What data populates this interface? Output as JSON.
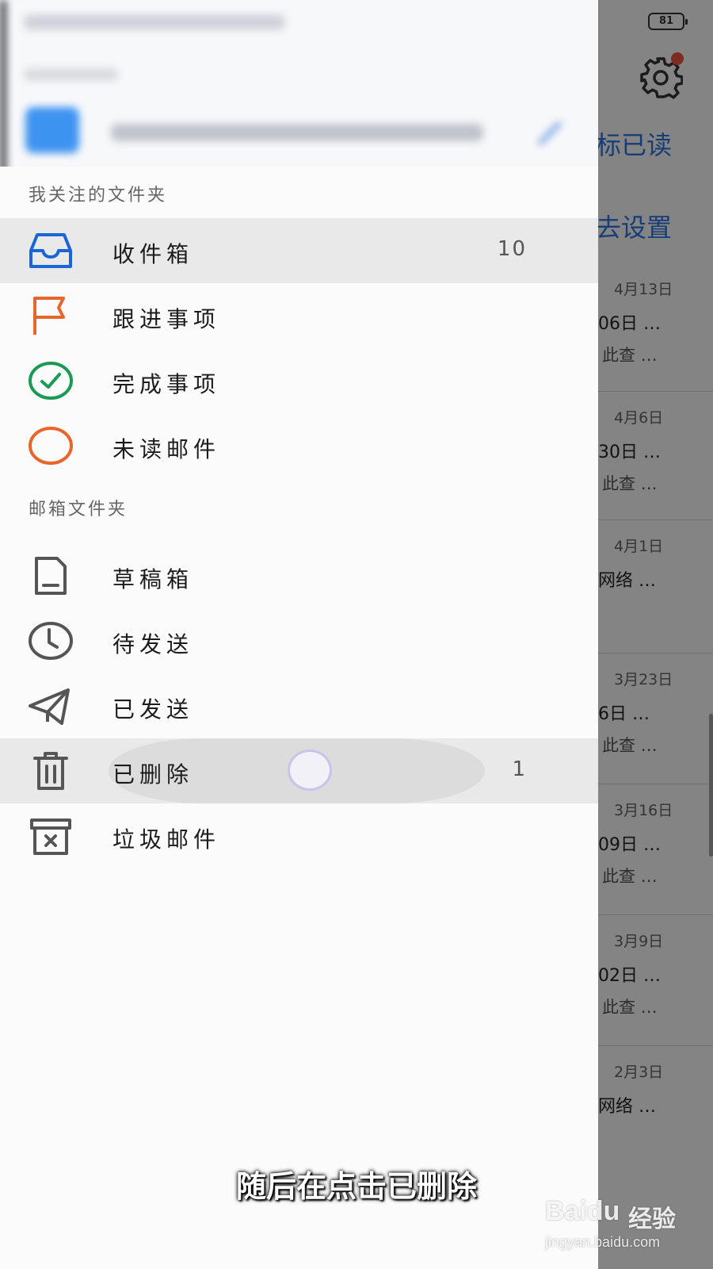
{
  "status": {
    "battery": "81"
  },
  "background": {
    "actions": [
      "标已读",
      "去设置"
    ],
    "rows": [
      {
        "date": "4月13日",
        "line1": "06日 …",
        "line2": "此查 …"
      },
      {
        "date": "4月6日",
        "line1": "30日 …",
        "line2": "此查 …"
      },
      {
        "date": "4月1日",
        "line1": "网络 …",
        "line2": ""
      },
      {
        "date": "3月23日",
        "line1": "6日 …",
        "line2": "此查 …"
      },
      {
        "date": "3月16日",
        "line1": "09日 …",
        "line2": "此查 …"
      },
      {
        "date": "3月9日",
        "line1": "02日 …",
        "line2": "此查 …"
      },
      {
        "date": "2月3日",
        "line1": "网络 …",
        "line2": ""
      }
    ]
  },
  "drawer": {
    "followed_title": "我关注的文件夹",
    "followed": [
      {
        "label": "收件箱",
        "icon": "inbox-icon",
        "count": "10",
        "active": true
      },
      {
        "label": "跟进事项",
        "icon": "flag-icon",
        "count": ""
      },
      {
        "label": "完成事项",
        "icon": "check-circle-icon",
        "count": ""
      },
      {
        "label": "未读邮件",
        "icon": "unread-circle-icon",
        "count": ""
      }
    ],
    "mailbox_title": "邮箱文件夹",
    "mailbox": [
      {
        "label": "草稿箱",
        "icon": "draft-icon",
        "count": ""
      },
      {
        "label": "待发送",
        "icon": "clock-icon",
        "count": ""
      },
      {
        "label": "已发送",
        "icon": "send-icon",
        "count": ""
      },
      {
        "label": "已删除",
        "icon": "trash-icon",
        "count": "1",
        "pressed": true
      },
      {
        "label": "垃圾邮件",
        "icon": "spam-box-icon",
        "count": ""
      }
    ]
  },
  "colors": {
    "accent": "#1a66d8",
    "flag": "#e8662b",
    "check": "#1b9a55",
    "unread": "#e8662b",
    "badge": "#e8442f"
  },
  "caption": "随后在点击已删除",
  "watermark": {
    "logo": "Baidu",
    "cn": "经验",
    "url": "jingyan.baidu.com"
  }
}
